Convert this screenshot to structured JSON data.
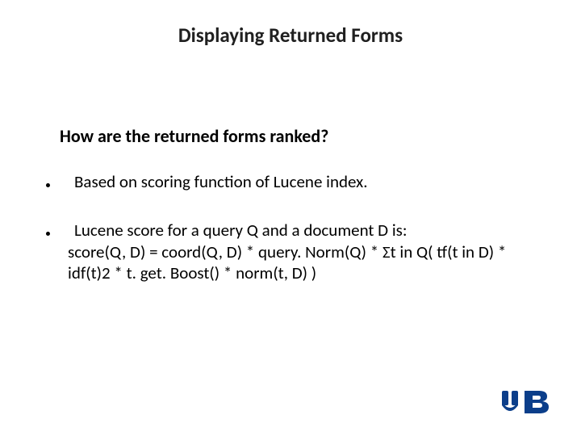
{
  "title": "Displaying Returned Forms",
  "subtitle": "How are the returned forms ranked?",
  "bullets": [
    {
      "text": "Based on scoring function of Lucene index."
    },
    {
      "line1": "Lucene score for a query Q and a document D is:",
      "line2": "score(Q, D) = coord(Q, D) * query. Norm(Q) * Σt in Q( tf(t in D) * idf(t)2 * t. get. Boost() * norm(t, D) )"
    }
  ],
  "logo_alt": "UB logo"
}
